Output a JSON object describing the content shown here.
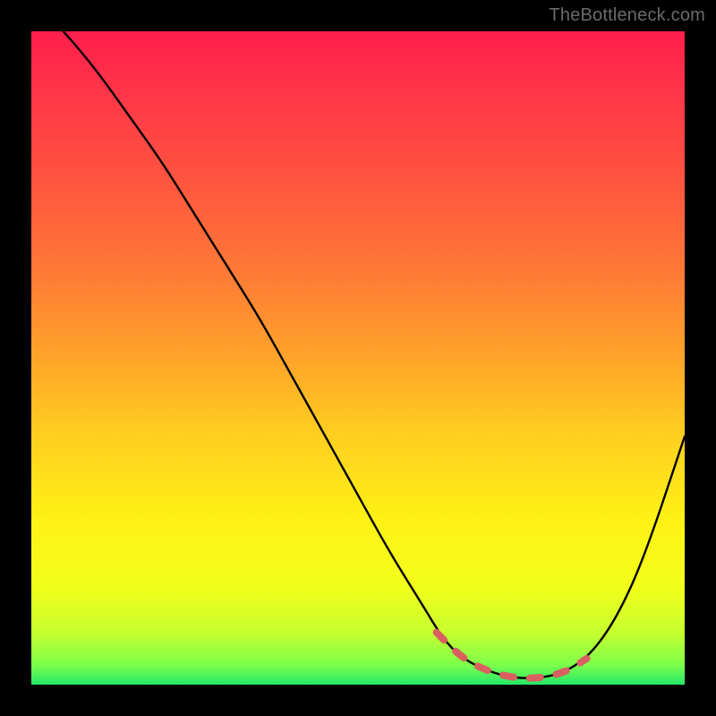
{
  "watermark": {
    "text": "TheBottleneck.com"
  },
  "colors": {
    "background": "#000000",
    "gradient_stops": [
      {
        "offset": 0.0,
        "color": "#ff1e4c"
      },
      {
        "offset": 0.12,
        "color": "#ff3b46"
      },
      {
        "offset": 0.25,
        "color": "#ff5a3e"
      },
      {
        "offset": 0.38,
        "color": "#ff7d35"
      },
      {
        "offset": 0.5,
        "color": "#ffa42a"
      },
      {
        "offset": 0.62,
        "color": "#ffcf20"
      },
      {
        "offset": 0.75,
        "color": "#fff215"
      },
      {
        "offset": 0.85,
        "color": "#f2ff1a"
      },
      {
        "offset": 0.92,
        "color": "#c7ff2f"
      },
      {
        "offset": 0.97,
        "color": "#7cff4a"
      },
      {
        "offset": 1.0,
        "color": "#23e86a"
      }
    ],
    "curve": "#000000",
    "marker": "#d86060"
  },
  "chart_data": {
    "type": "line",
    "title": "",
    "xlabel": "",
    "ylabel": "",
    "xlim": [
      0,
      100
    ],
    "ylim": [
      0,
      100
    ],
    "grid": false,
    "legend": false,
    "series": [
      {
        "name": "bottleneck-curve",
        "x": [
          0,
          5,
          10,
          15,
          20,
          25,
          30,
          35,
          40,
          45,
          50,
          55,
          60,
          63,
          66,
          70,
          74,
          78,
          82,
          86,
          90,
          94,
          100
        ],
        "y": [
          105,
          100,
          94,
          87,
          80,
          72,
          64,
          56,
          47,
          38,
          29,
          20,
          12,
          7,
          4,
          2,
          1,
          1,
          2,
          5,
          11,
          20,
          38
        ]
      }
    ],
    "markers": {
      "name": "highlighted-optimal-region",
      "x": [
        62,
        66,
        70,
        74,
        78,
        82,
        85
      ],
      "y": [
        8,
        4,
        2,
        1,
        1,
        2,
        4
      ]
    },
    "annotations": []
  }
}
